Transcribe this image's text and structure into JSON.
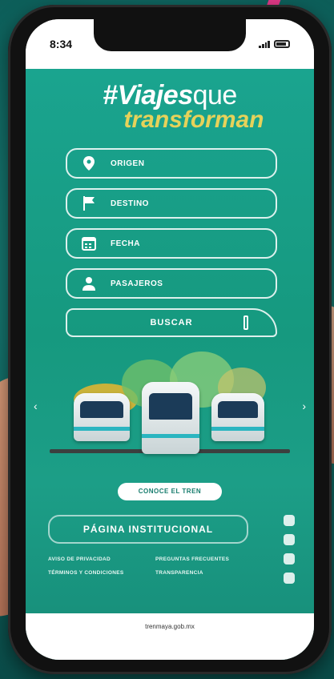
{
  "status_bar": {
    "time": "8:34"
  },
  "logo": {
    "line1_bold": "#Viajes",
    "line1_light": "que",
    "line2": "transforman"
  },
  "form": {
    "fields": [
      {
        "icon": "location-pin-icon",
        "label": "ORIGEN"
      },
      {
        "icon": "flag-icon",
        "label": "DESTINO"
      },
      {
        "icon": "calendar-icon",
        "label": "FECHA"
      },
      {
        "icon": "person-icon",
        "label": "PASAJEROS"
      }
    ],
    "submit_label": "BUSCAR"
  },
  "hero": {
    "cta_label": "CONOCE EL TREN"
  },
  "footer": {
    "institutional_button": "PÁGINA INSTITUCIONAL",
    "links": [
      "AVISO DE PRIVACIDAD",
      "PREGUNTAS FRECUENTES",
      "TÉRMINOS Y CONDICIONES",
      "TRANSPARENCIA"
    ],
    "social_icons": [
      "x-icon",
      "instagram-icon",
      "facebook-icon",
      "youtube-icon"
    ]
  },
  "browser_url": "trenmaya.gob.mx",
  "colors": {
    "brand_green": "#1aa48f",
    "logo_yellow": "#e6d25a"
  }
}
